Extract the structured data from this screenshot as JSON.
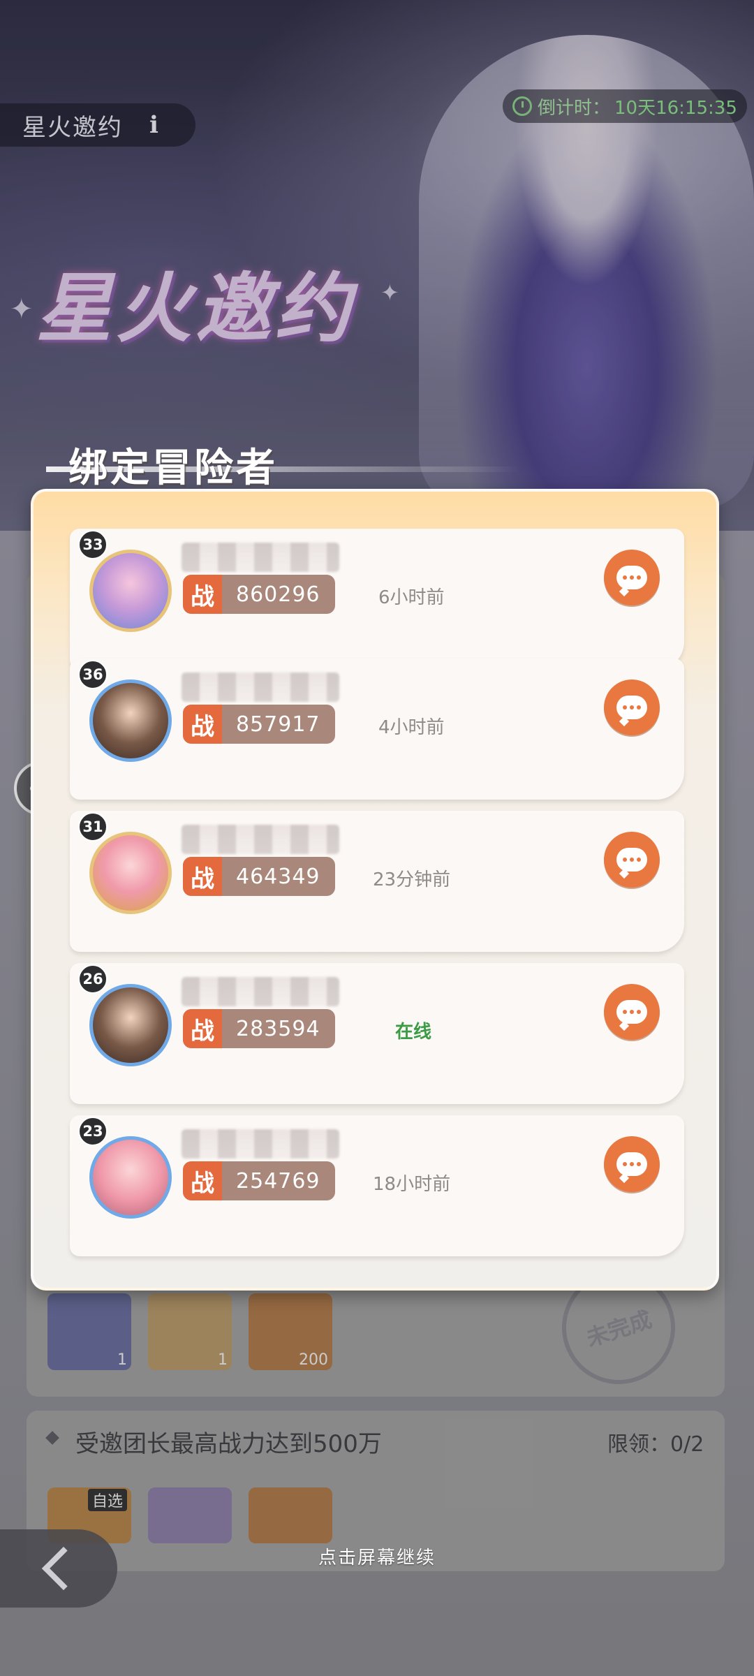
{
  "header": {
    "title": "星火邀约",
    "info_label": "i",
    "countdown_label": "倒计时：",
    "countdown_value": "10天16:15:35"
  },
  "banner": {
    "logo_text": "星火邀约"
  },
  "modal": {
    "title": "绑定冒险者",
    "power_tag": "战",
    "players": [
      {
        "level": "33",
        "power": "860296",
        "status": "6小时前",
        "online": false,
        "avatar": "pink-hair-character-avatar"
      },
      {
        "level": "36",
        "power": "857917",
        "status": "4小时前",
        "online": false,
        "avatar": "dark-hair-male-character-avatar"
      },
      {
        "level": "31",
        "power": "464349",
        "status": "23分钟前",
        "online": false,
        "avatar": "pink-hair-fox-girl-avatar"
      },
      {
        "level": "26",
        "power": "283594",
        "status": "在线",
        "online": true,
        "avatar": "dark-hair-male-character-avatar"
      },
      {
        "level": "23",
        "power": "254769",
        "status": "18小时前",
        "online": false,
        "avatar": "pink-hair-fox-girl-avatar"
      }
    ]
  },
  "background": {
    "task_text": "受邀团长最高战力达到500万",
    "task_limit": "限领：0/2",
    "stamp_text": "未完成",
    "item_counts": [
      "1",
      "1",
      "200"
    ],
    "item_tag": "自选"
  },
  "footer": {
    "continue_text": "点击屏幕继续"
  },
  "colors": {
    "accent": "#e87840",
    "power_tag": "#e46a3e",
    "online": "#3c9b45",
    "countdown": "#8ee38e"
  }
}
